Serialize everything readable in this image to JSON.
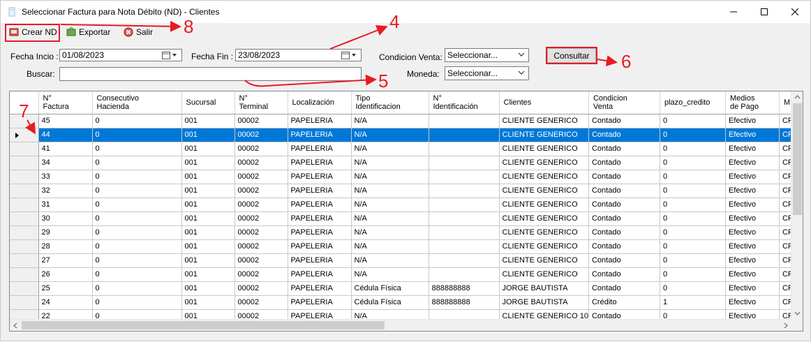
{
  "window": {
    "title": "Seleccionar Factura para Nota Débito (ND) - Clientes"
  },
  "toolbar": {
    "crear_nd": "Crear ND",
    "exportar": "Exportar",
    "salir": "Salir"
  },
  "filters": {
    "fecha_inicio_label": "Fecha Incio :",
    "fecha_inicio_value": "01/08/2023",
    "fecha_fin_label": "Fecha Fin :",
    "fecha_fin_value": "23/08/2023",
    "buscar_label": "Buscar:",
    "buscar_value": "",
    "condicion_venta_label": "Condicion Venta:",
    "condicion_venta_value": "Seleccionar...",
    "moneda_label": "Moneda:",
    "moneda_value": "Seleccionar...",
    "consultar_label": "Consultar"
  },
  "grid": {
    "columns": [
      "N°\nFactura",
      "Consecutivo\nHacienda",
      "Sucursal",
      "N°\nTerminal",
      "Localización",
      "Tipo\nIdentificacion",
      "N°\nIdentificación",
      "Clientes",
      "Condicion\nVenta",
      "plazo_credito",
      "Medios\nde Pago",
      "M"
    ],
    "selected_row": 1,
    "rows": [
      [
        "45",
        "0",
        "001",
        "00002",
        "PAPELERIA",
        "N/A",
        "",
        "CLIENTE GENERICO",
        "Contado",
        "0",
        "Efectivo",
        "CR"
      ],
      [
        "44",
        "0",
        "001",
        "00002",
        "PAPELERIA",
        "N/A",
        "",
        "CLIENTE GENERICO",
        "Contado",
        "0",
        "Efectivo",
        "CR"
      ],
      [
        "41",
        "0",
        "001",
        "00002",
        "PAPELERIA",
        "N/A",
        "",
        "CLIENTE GENERICO",
        "Contado",
        "0",
        "Efectivo",
        "CR"
      ],
      [
        "34",
        "0",
        "001",
        "00002",
        "PAPELERIA",
        "N/A",
        "",
        "CLIENTE GENERICO",
        "Contado",
        "0",
        "Efectivo",
        "CR"
      ],
      [
        "33",
        "0",
        "001",
        "00002",
        "PAPELERIA",
        "N/A",
        "",
        "CLIENTE GENERICO",
        "Contado",
        "0",
        "Efectivo",
        "CR"
      ],
      [
        "32",
        "0",
        "001",
        "00002",
        "PAPELERIA",
        "N/A",
        "",
        "CLIENTE GENERICO",
        "Contado",
        "0",
        "Efectivo",
        "CR"
      ],
      [
        "31",
        "0",
        "001",
        "00002",
        "PAPELERIA",
        "N/A",
        "",
        "CLIENTE GENERICO",
        "Contado",
        "0",
        "Efectivo",
        "CR"
      ],
      [
        "30",
        "0",
        "001",
        "00002",
        "PAPELERIA",
        "N/A",
        "",
        "CLIENTE GENERICO",
        "Contado",
        "0",
        "Efectivo",
        "CR"
      ],
      [
        "29",
        "0",
        "001",
        "00002",
        "PAPELERIA",
        "N/A",
        "",
        "CLIENTE GENERICO",
        "Contado",
        "0",
        "Efectivo",
        "CR"
      ],
      [
        "28",
        "0",
        "001",
        "00002",
        "PAPELERIA",
        "N/A",
        "",
        "CLIENTE GENERICO",
        "Contado",
        "0",
        "Efectivo",
        "CR"
      ],
      [
        "27",
        "0",
        "001",
        "00002",
        "PAPELERIA",
        "N/A",
        "",
        "CLIENTE GENERICO",
        "Contado",
        "0",
        "Efectivo",
        "CR"
      ],
      [
        "26",
        "0",
        "001",
        "00002",
        "PAPELERIA",
        "N/A",
        "",
        "CLIENTE GENERICO",
        "Contado",
        "0",
        "Efectivo",
        "CR"
      ],
      [
        "25",
        "0",
        "001",
        "00002",
        "PAPELERIA",
        "Cédula Física",
        "888888888",
        "JORGE BAUTISTA",
        "Contado",
        "0",
        "Efectivo",
        "CR"
      ],
      [
        "24",
        "0",
        "001",
        "00002",
        "PAPELERIA",
        "Cédula Física",
        "888888888",
        "JORGE BAUTISTA",
        "Crédito",
        "1",
        "Efectivo",
        "CR"
      ],
      [
        "22",
        "0",
        "001",
        "00002",
        "PAPELERIA",
        "N/A",
        "",
        "CLIENTE GENERICO 10",
        "Contado",
        "0",
        "Efectivo",
        "CR"
      ]
    ]
  },
  "annotations": {
    "n4": "4",
    "n5": "5",
    "n6": "6",
    "n7": "7",
    "n8": "8",
    "color": "#e81b23"
  },
  "colors": {
    "selection": "#0078d7",
    "window_bg": "#f0f0f0"
  }
}
